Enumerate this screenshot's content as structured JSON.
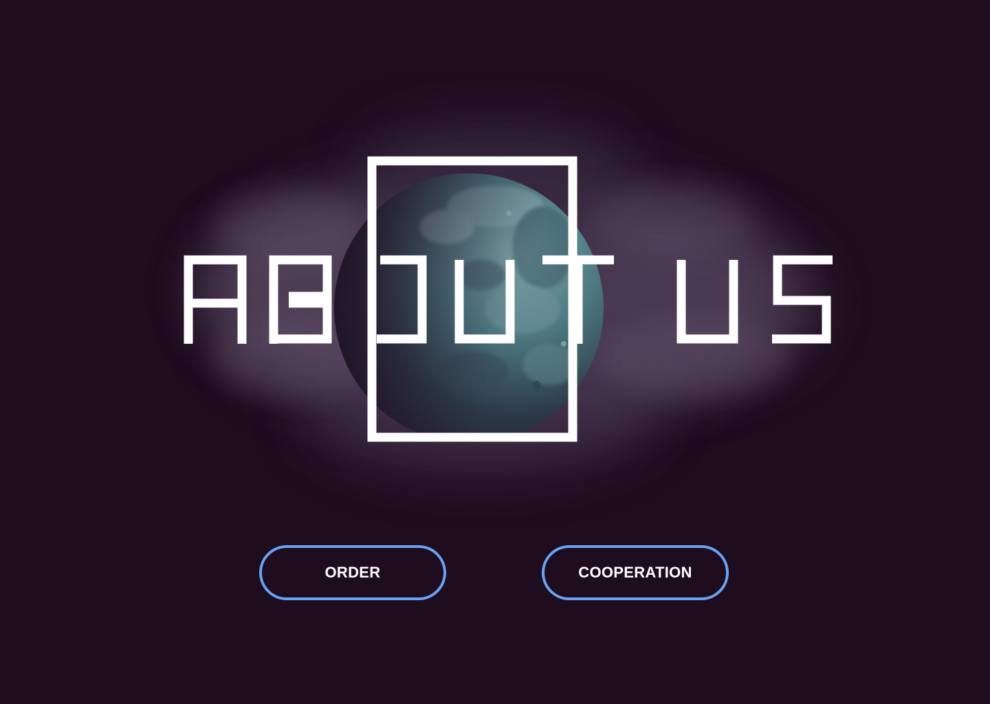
{
  "hero": {
    "title": "ABOUT US"
  },
  "actions": {
    "order_label": "ORDER",
    "cooperation_label": "COOPERATION"
  },
  "colors": {
    "background": "#1e0c1f",
    "button_border": "#6aa2f3",
    "title": "#ffffff",
    "planet": "#4f7a82"
  }
}
